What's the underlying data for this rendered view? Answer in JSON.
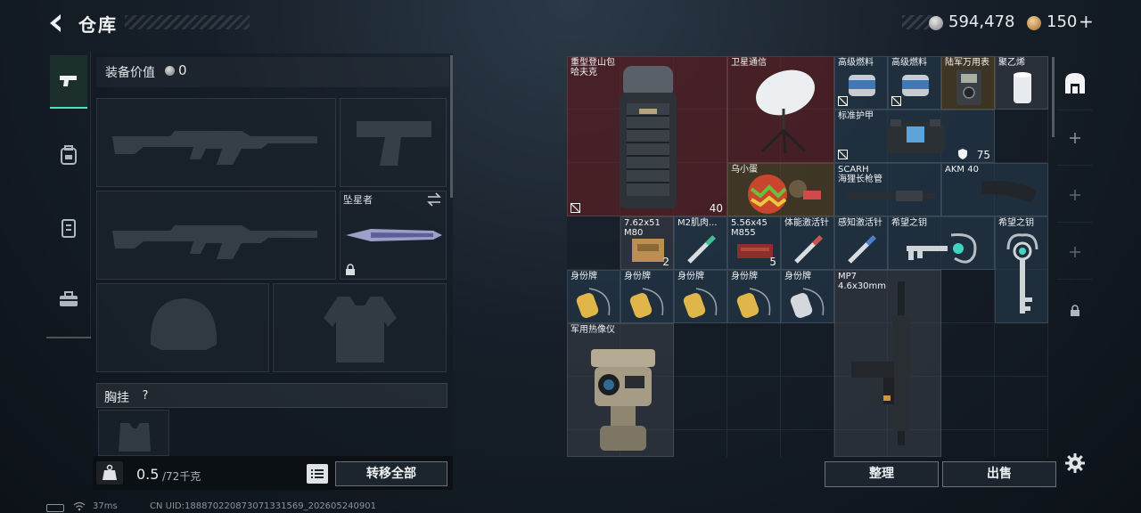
{
  "header": {
    "title": "仓库",
    "silver_amount": "594,478",
    "gold_amount": "150",
    "gold_plus": "+",
    "icons": {
      "back": "back-arrow-icon",
      "silver": "silver-coin-icon",
      "gold": "gold-coin-icon"
    }
  },
  "left_tabs": [
    {
      "name": "weapon-tab",
      "icon": "pistol-icon",
      "active": true
    },
    {
      "name": "backpack-tab",
      "icon": "backpack-icon",
      "active": false
    },
    {
      "name": "armor-tab",
      "icon": "vest-icon",
      "active": false
    },
    {
      "name": "toolbox-tab",
      "icon": "toolbox-icon",
      "active": false
    }
  ],
  "loadout": {
    "equip_value_label": "装备价值",
    "equip_value_amount": "0",
    "melee_name": "坠星者",
    "chest_rig_label": "胸挂",
    "chest_help": "?",
    "weight_value": "0.5",
    "weight_max": "/72千克",
    "transfer_all": "转移全部"
  },
  "warehouse": {
    "items": [
      {
        "id": "backpack",
        "name": "重型登山包",
        "name2": "哈夫克",
        "count": "40",
        "rarity": "red"
      },
      {
        "id": "sat-comm",
        "name": "卫星通信",
        "rarity": "red"
      },
      {
        "id": "fuel-1",
        "name": "高级燃料",
        "rarity": "blue"
      },
      {
        "id": "fuel-2",
        "name": "高级燃料",
        "rarity": "blue"
      },
      {
        "id": "army-meter",
        "name": "陆军万用表",
        "rarity": "gold"
      },
      {
        "id": "poly",
        "name": "聚乙烯",
        "rarity": "gray"
      },
      {
        "id": "armor",
        "name": "标准护甲",
        "count": "75",
        "rarity": "blue"
      },
      {
        "id": "egg",
        "name": "乌小蛋",
        "rarity": "gold"
      },
      {
        "id": "scarh",
        "name": "SCARH",
        "name2": "海狸长枪管",
        "rarity": "blue"
      },
      {
        "id": "akm",
        "name": "AKM 40",
        "rarity": "blue"
      },
      {
        "id": "ammo-762",
        "name": "7.62x51",
        "name2": "M80",
        "count": "2",
        "rarity": "gray"
      },
      {
        "id": "m2",
        "name": "M2肌肉...",
        "rarity": "blue"
      },
      {
        "id": "ammo-556",
        "name": "5.56x45",
        "name2": "M855",
        "count": "5",
        "rarity": "blue"
      },
      {
        "id": "stamina",
        "name": "体能激活针",
        "rarity": "blue"
      },
      {
        "id": "perception",
        "name": "感知激活针",
        "rarity": "blue"
      },
      {
        "id": "key-hope-1",
        "name": "希望之钥",
        "rarity": "blue"
      },
      {
        "id": "key-hope-2",
        "name": "希望之钥",
        "rarity": "blue"
      },
      {
        "id": "tag-1",
        "name": "身份牌",
        "rarity": "blue"
      },
      {
        "id": "tag-2",
        "name": "身份牌",
        "rarity": "blue"
      },
      {
        "id": "tag-3",
        "name": "身份牌",
        "rarity": "blue"
      },
      {
        "id": "tag-4",
        "name": "身份牌",
        "rarity": "blue"
      },
      {
        "id": "tag-5",
        "name": "身份牌",
        "rarity": "blue"
      },
      {
        "id": "mp7",
        "name": "MP7",
        "name2": "4.6x30mm",
        "rarity": "gray"
      },
      {
        "id": "thermal",
        "name": "军用热像仪",
        "rarity": "gray"
      }
    ]
  },
  "buttons": {
    "sort": "整理",
    "sell": "出售"
  },
  "status_bar": {
    "ping": "37ms",
    "uid": "CN UID:188870220873071331569_202605240901"
  },
  "colors": {
    "accent": "#4fe0bd",
    "red_tier": "#641e24",
    "blue_tier": "#283e52",
    "gold_tier": "#604822"
  }
}
